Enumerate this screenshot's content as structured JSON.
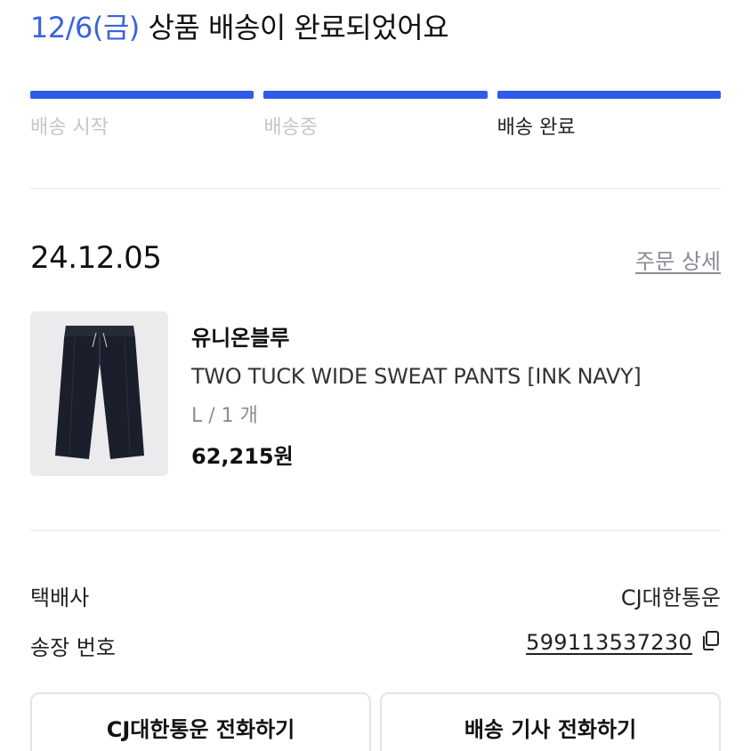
{
  "header": {
    "date": "12/6(금)",
    "message": "상품 배송이 완료되었어요"
  },
  "progress": {
    "steps": [
      {
        "label": "배송 시작",
        "state": "done"
      },
      {
        "label": "배송중",
        "state": "done"
      },
      {
        "label": "배송 완료",
        "state": "current"
      }
    ],
    "bar_color": "#2f5bea"
  },
  "order": {
    "date": "24.12.05",
    "detail_link": "주문 상세"
  },
  "product": {
    "image": "pants-icon",
    "brand": "유니온블루",
    "name": "TWO TUCK WIDE SWEAT PANTS [INK NAVY]",
    "option": "L / 1 개",
    "price": "62,215원"
  },
  "shipping": {
    "carrier_label": "택배사",
    "carrier_value": "CJ대한통운",
    "tracking_label": "송장 번호",
    "tracking_number": "599113537230",
    "copy_icon": "copy-icon"
  },
  "buttons": {
    "call_carrier": "CJ대한통운 전화하기",
    "call_driver": "배송 기사 전화하기"
  },
  "colors": {
    "accent_date": "#3a64dc",
    "progress": "#2f5bea"
  }
}
